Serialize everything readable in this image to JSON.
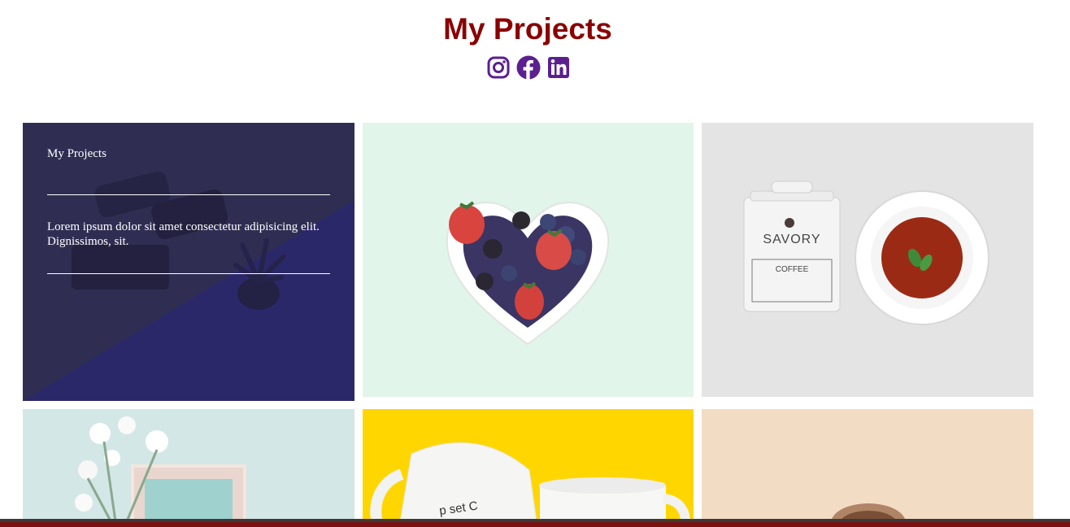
{
  "header": {
    "title": "My Projects",
    "social": [
      "instagram-icon",
      "facebook-icon",
      "linkedin-icon"
    ],
    "title_color": "#8b0000",
    "icon_color": "#5b1f8f"
  },
  "projects": [
    {
      "image": "sunglasses-plant-on-desk",
      "overlay": {
        "title": "My Projects",
        "text": "Lorem ipsum dolor sit amet consectetur adipisicing elit. Dignissimos, sit."
      },
      "overlay_color": "#2a2560"
    },
    {
      "image": "heart-bowl-of-berries"
    },
    {
      "image": "savory-coffee-tin-and-soup-plate"
    },
    {
      "image": "white-flowers-and-frame"
    },
    {
      "image": "white-mugs-on-yellow"
    },
    {
      "image": "coffee-cup-on-peach"
    }
  ],
  "footer": {
    "bar_color": "#7a1010"
  }
}
